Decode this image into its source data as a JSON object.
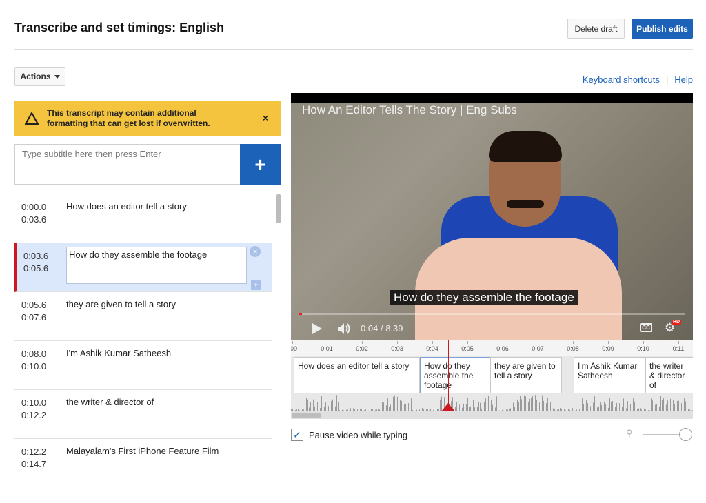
{
  "header": {
    "title": "Transcribe and set timings: English",
    "delete_draft": "Delete draft",
    "publish_edits": "Publish edits"
  },
  "toolbar": {
    "actions_label": "Actions",
    "keyboard_shortcuts": "Keyboard shortcuts",
    "separator": "|",
    "help": "Help"
  },
  "warning": {
    "message": "This transcript may contain additional formatting that can get lost if overwritten.",
    "close": "×"
  },
  "subtitle_input": {
    "placeholder": "Type subtitle here then press Enter",
    "add_label": "+"
  },
  "subtitles": [
    {
      "start": "0:00.0",
      "end": "0:03.6",
      "text": "How does an editor tell a story"
    },
    {
      "start": "0:03.6",
      "end": "0:05.6",
      "text": "How do they assemble the footage",
      "active": true
    },
    {
      "start": "0:05.6",
      "end": "0:07.6",
      "text": "they are given to tell a story"
    },
    {
      "start": "0:08.0",
      "end": "0:10.0",
      "text": "I'm Ashik Kumar Satheesh"
    },
    {
      "start": "0:10.0",
      "end": "0:12.2",
      "text": "the writer & director of"
    },
    {
      "start": "0:12.2",
      "end": "0:14.7",
      "text": "Malayalam's First iPhone Feature Film"
    }
  ],
  "video": {
    "title": "How An Editor Tells The Story | Eng Subs",
    "caption": "How do they assemble the footage",
    "time_current": "0:04",
    "time_total": "8:39",
    "time_separator": "/",
    "cc": "CC",
    "hd": "HD",
    "progress": 0.008
  },
  "timeline": {
    "ticks": [
      "00",
      "0:01",
      "0:02",
      "0:03",
      "0:04",
      "0:05",
      "0:06",
      "0:07",
      "0:08",
      "0:09",
      "0:10",
      "0:11"
    ],
    "segments": [
      "How does an editor tell a story",
      "How do they assemble the footage",
      "they are given to tell a story",
      "I'm Ashik Kumar Satheesh",
      "the writer & director of"
    ]
  },
  "options": {
    "pause_while_typing": "Pause video while typing",
    "pause_checked": true,
    "zoom_level": 1.0
  },
  "colors": {
    "accent": "#1c62b9",
    "warning_bg": "#f4c43e",
    "active_row": "#dbe8fb",
    "playhead": "#cc181e"
  }
}
